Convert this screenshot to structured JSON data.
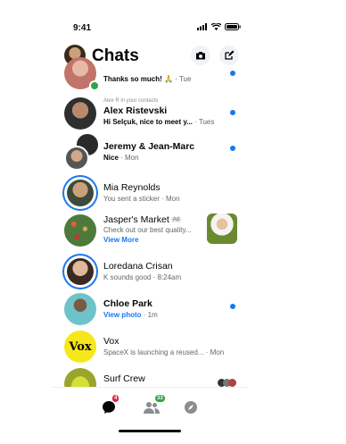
{
  "status_bar": {
    "time": "9:41"
  },
  "header": {
    "title": "Chats"
  },
  "chats": [
    {
      "name": "",
      "preview": "Thanks so much! 🙏",
      "time": " · Tue",
      "unread": true
    },
    {
      "context": "Alex R in your contacts",
      "name": "Alex Ristevski",
      "preview": "Hi Selçuk, nice to meet y...",
      "time": " · Tues",
      "unread": true
    },
    {
      "name": "Jeremy & Jean-Marc",
      "preview": "Nice",
      "time": " · Mon",
      "unread": true
    },
    {
      "name": "Mia Reynolds",
      "preview": "You sent a sticker · Mon",
      "unread": false
    },
    {
      "name": "Jasper's Market",
      "ad_label": "Ad",
      "preview": "Check out our best quality...",
      "link": "View More",
      "unread": false
    },
    {
      "name": "Loredana Crisan",
      "preview": "K sounds good · 8:24am",
      "unread": false
    },
    {
      "name": "Chloe Park",
      "preview": "View photo",
      "time": " · 1m",
      "unread": true
    },
    {
      "name": "Vox",
      "avatar_text": "Vox",
      "preview": "SpaceX is launching a reused... · Mon",
      "unread": false
    },
    {
      "name": "Surf Crew",
      "preview": "",
      "unread": false
    }
  ],
  "tabs": [
    {
      "name": "chats",
      "badge": "4",
      "badge_color": "#e41e3f"
    },
    {
      "name": "people",
      "badge": "33",
      "badge_color": "#31a24c"
    },
    {
      "name": "discover",
      "badge": ""
    }
  ],
  "colors": {
    "accent": "#1877f2",
    "online": "#31a24c"
  }
}
